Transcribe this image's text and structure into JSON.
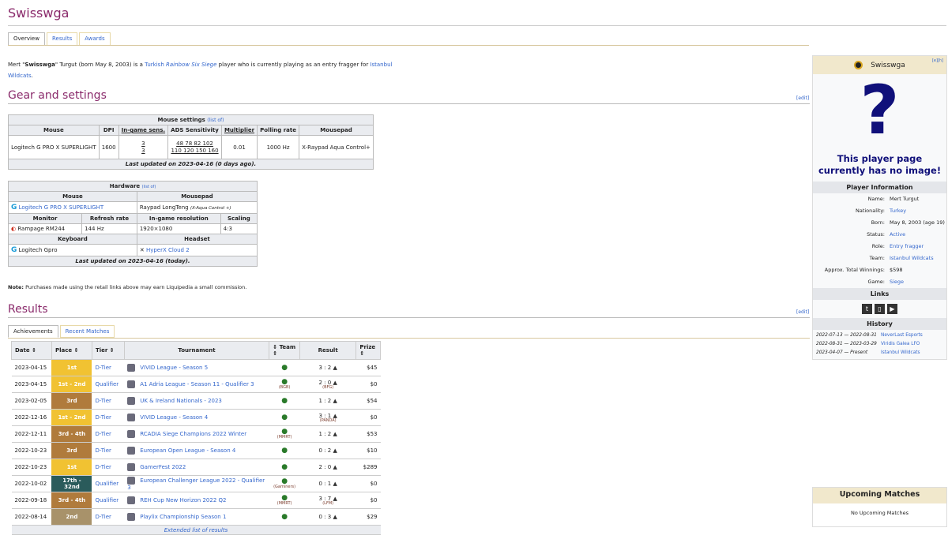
{
  "title": "Swisswga",
  "tabs": [
    "Overview",
    "Results",
    "Awards"
  ],
  "intro": {
    "p1": "Mert \"",
    "nick": "Swisswga",
    "p2": "\" Turgut (born May 8, 2003) is a ",
    "nat": "Turkish",
    "game": "Rainbow Six Siege",
    "p3": " player who is currently playing as an entry fragger for ",
    "team": "Istanbul Wildcats",
    "p4": "."
  },
  "gear": {
    "heading": "Gear and settings",
    "edit": "[edit]",
    "mouse_settings": {
      "title": "Mouse settings",
      "list": "(list of)",
      "headers": [
        "Mouse",
        "DPI",
        "In-game sens.",
        "ADS Sensitivity",
        "Multiplier",
        "Polling rate",
        "Mousepad"
      ],
      "row": {
        "mouse": "Logitech G PRO X SUPERLIGHT",
        "dpi": "1600",
        "sens1": "3",
        "sens2": "3",
        "ads1": "48  78  82  102",
        "ads2": "110  120  150  160",
        "mult": "0.01",
        "poll": "1000 Hz",
        "pad": "X-Raypad Aqua Control+"
      },
      "updated": "Last updated on 2023-04-16 (0 days ago)."
    },
    "hardware": {
      "title": "Hardware",
      "list": "(list of)",
      "h_mouse": "Mouse",
      "h_pad": "Mousepad",
      "mouse": "Logitech G PRO X SUPERLIGHT",
      "pad": "Raypad LongTeng",
      "pad_note": "(X-Aqua Control +)",
      "h_mon": "Monitor",
      "h_ref": "Refresh rate",
      "h_res": "In-game resolution",
      "h_scale": "Scaling",
      "monitor": "Rampage RM244",
      "refresh": "144 Hz",
      "res": "1920×1080",
      "scale": "4:3",
      "h_kb": "Keyboard",
      "h_head": "Headset",
      "keyboard": "Logitech Gpro",
      "headset": "HyperX Cloud 2",
      "updated": "Last updated on 2023-04-16 (today)."
    },
    "note_b": "Note:",
    "note": " Purchases made using the retail links above may earn Liquipedia a small commission."
  },
  "results": {
    "heading": "Results",
    "edit": "[edit]",
    "subtabs": [
      "Achievements",
      "Recent Matches"
    ],
    "headers": [
      "Date",
      "Place",
      "Tier",
      "Tournament",
      "Team",
      "Result",
      "Prize"
    ],
    "rows": [
      {
        "date": "2023-04-15",
        "place": "1st",
        "cls": "first",
        "tier": "D-Tier",
        "tourn": "VIVID League - Season 5",
        "score": "3 : 2",
        "t1": "",
        "t2": "",
        "prize": "$45"
      },
      {
        "date": "2023-04-15",
        "place": "1st - 2nd",
        "cls": "first",
        "tier": "Qualifier",
        "tourn": "A1 Adria League - Season 11 - Qualifier 3",
        "score": "2 : 0",
        "t1": "(BGB)",
        "t2": "(BFG)",
        "prize": "$0"
      },
      {
        "date": "2023-02-05",
        "place": "3rd",
        "cls": "third",
        "tier": "D-Tier",
        "tourn": "UK & Ireland Nationals - 2023",
        "score": "1 : 2",
        "t1": "",
        "t2": "",
        "prize": "$54"
      },
      {
        "date": "2022-12-16",
        "place": "1st - 2nd",
        "cls": "first",
        "tier": "D-Tier",
        "tourn": "VIVID League - Season 4",
        "score": "3 : 1",
        "t1": "",
        "t2": "(PANDA)",
        "prize": "$0"
      },
      {
        "date": "2022-12-11",
        "place": "3rd - 4th",
        "cls": "third",
        "tier": "D-Tier",
        "tourn": "RCADIA Siege Champions 2022 Winter",
        "score": "1 : 2",
        "t1": "(MMRT)",
        "t2": "",
        "prize": "$53"
      },
      {
        "date": "2022-10-23",
        "place": "3rd",
        "cls": "third",
        "tier": "D-Tier",
        "tourn": "European Open League - Season 4",
        "score": "0 : 2",
        "t1": "",
        "t2": "",
        "prize": "$10"
      },
      {
        "date": "2022-10-23",
        "place": "1st",
        "cls": "first",
        "tier": "D-Tier",
        "tourn": "GamerFest 2022",
        "score": "2 : 0",
        "t1": "",
        "t2": "",
        "prize": "$289"
      },
      {
        "date": "2022-10-02",
        "place": "17th - 32nd",
        "cls": "top32",
        "tier": "Qualifier",
        "tourn": "European Challenger League 2022 - Qualifier 3",
        "score": "0 : 1",
        "t1": "(Gaminers)",
        "t2": "",
        "prize": "$0"
      },
      {
        "date": "2022-09-18",
        "place": "3rd - 4th",
        "cls": "third",
        "tier": "Qualifier",
        "tourn": "REH Cup New Horizon 2022 Q2",
        "score": "3 : 7",
        "t1": "(MMRT)",
        "t2": "(LFM)",
        "prize": "$0"
      },
      {
        "date": "2022-08-14",
        "place": "2nd",
        "cls": "second",
        "tier": "D-Tier",
        "tourn": "Playlix Championship Season 1",
        "score": "0 : 3",
        "t1": "",
        "t2": "",
        "prize": "$29"
      }
    ],
    "extended": "Extended list of results"
  },
  "infobox": {
    "name": "Swisswga",
    "edit": "[e][h]",
    "qmark": "?",
    "noimg": "This player page currently has no image!",
    "sec_info": "Player Information",
    "rows": [
      {
        "k": "Name:",
        "v": "Mert Turgut"
      },
      {
        "k": "Nationality:",
        "v": "Turkey"
      },
      {
        "k": "Born:",
        "v": "May 8, 2003 (age 19)"
      },
      {
        "k": "Status:",
        "v": "Active"
      },
      {
        "k": "Role:",
        "v": "Entry fragger"
      },
      {
        "k": "Team:",
        "v": "Istanbul Wildcats"
      },
      {
        "k": "Approx. Total Winnings:",
        "v": "$598"
      },
      {
        "k": "Game:",
        "v": "Siege"
      }
    ],
    "sec_links": "Links",
    "sec_hist": "History",
    "history": [
      {
        "d": "2022-07-13 — 2022-08-31",
        "t": "NeverLast Esports"
      },
      {
        "d": "2022-08-31 — 2023-03-29",
        "t": "Viridis Galea LFO"
      },
      {
        "d": "2023-04-07 — Present",
        "t": "Istanbul Wildcats"
      }
    ]
  },
  "upcoming": {
    "title": "Upcoming Matches",
    "none": "No Upcoming Matches"
  },
  "colors": {
    "heading": "#8a2a6b",
    "link": "#3366cc",
    "gold": "#f1c232",
    "bronze": "#b07b3c"
  }
}
